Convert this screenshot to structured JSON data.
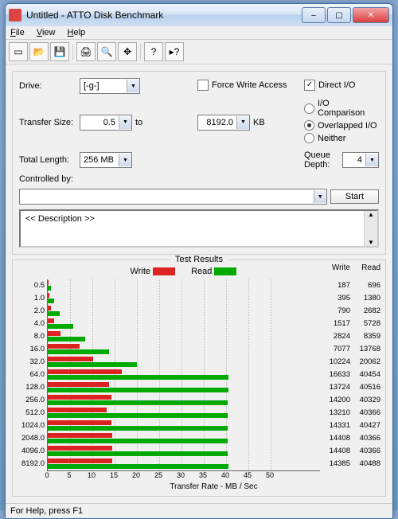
{
  "window": {
    "title": "Untitled - ATTO Disk Benchmark"
  },
  "menu": {
    "file": "File",
    "view": "View",
    "help": "Help"
  },
  "toolbar_icons": {
    "new": "new-icon",
    "open": "open-icon",
    "save": "save-icon",
    "print": "print-icon",
    "preview": "preview-icon",
    "move": "move-icon",
    "help": "help-icon",
    "context": "context-help-icon"
  },
  "controls": {
    "drive_label": "Drive:",
    "drive_value": "[-g-]",
    "transfer_label": "Transfer Size:",
    "transfer_from": "0.5",
    "to": "to",
    "transfer_to": "8192.0",
    "kb": "KB",
    "total_label": "Total Length:",
    "total_value": "256 MB",
    "force_write": "Force Write Access",
    "direct_io": "Direct I/O",
    "io_comparison": "I/O Comparison",
    "overlapped_io": "Overlapped I/O",
    "neither": "Neither",
    "queue_depth_label": "Queue Depth:",
    "queue_depth_value": "4",
    "controlled_by": "Controlled by:",
    "start": "Start",
    "description": "<< Description >>"
  },
  "results": {
    "title": "Test Results",
    "write_label": "Write",
    "read_label": "Read",
    "xlabel": "Transfer Rate - MB / Sec"
  },
  "chart_data": {
    "type": "bar",
    "orientation": "horizontal",
    "categories": [
      "0.5",
      "1.0",
      "2.0",
      "4.0",
      "8.0",
      "16.0",
      "32.0",
      "64.0",
      "128.0",
      "256.0",
      "512.0",
      "1024.0",
      "2048.0",
      "4096.0",
      "8192.0"
    ],
    "series": [
      {
        "name": "Write",
        "color": "#d22222",
        "values": [
          187,
          395,
          790,
          1517,
          2824,
          7077,
          10224,
          16633,
          13724,
          14200,
          13210,
          14331,
          14408,
          14408,
          14385
        ]
      },
      {
        "name": "Read",
        "color": "#009900",
        "values": [
          696,
          1380,
          2682,
          5728,
          8359,
          13768,
          20062,
          40454,
          40516,
          40329,
          40366,
          40427,
          40366,
          40366,
          40488
        ]
      }
    ],
    "xlabel": "Transfer Rate - MB / Sec",
    "xlim": [
      0,
      50
    ],
    "xticks": [
      0,
      5,
      10,
      15,
      20,
      25,
      30,
      35,
      40,
      45,
      50
    ],
    "x_unit_divisor": 1000
  },
  "statusbar": {
    "text": "For Help, press F1"
  }
}
